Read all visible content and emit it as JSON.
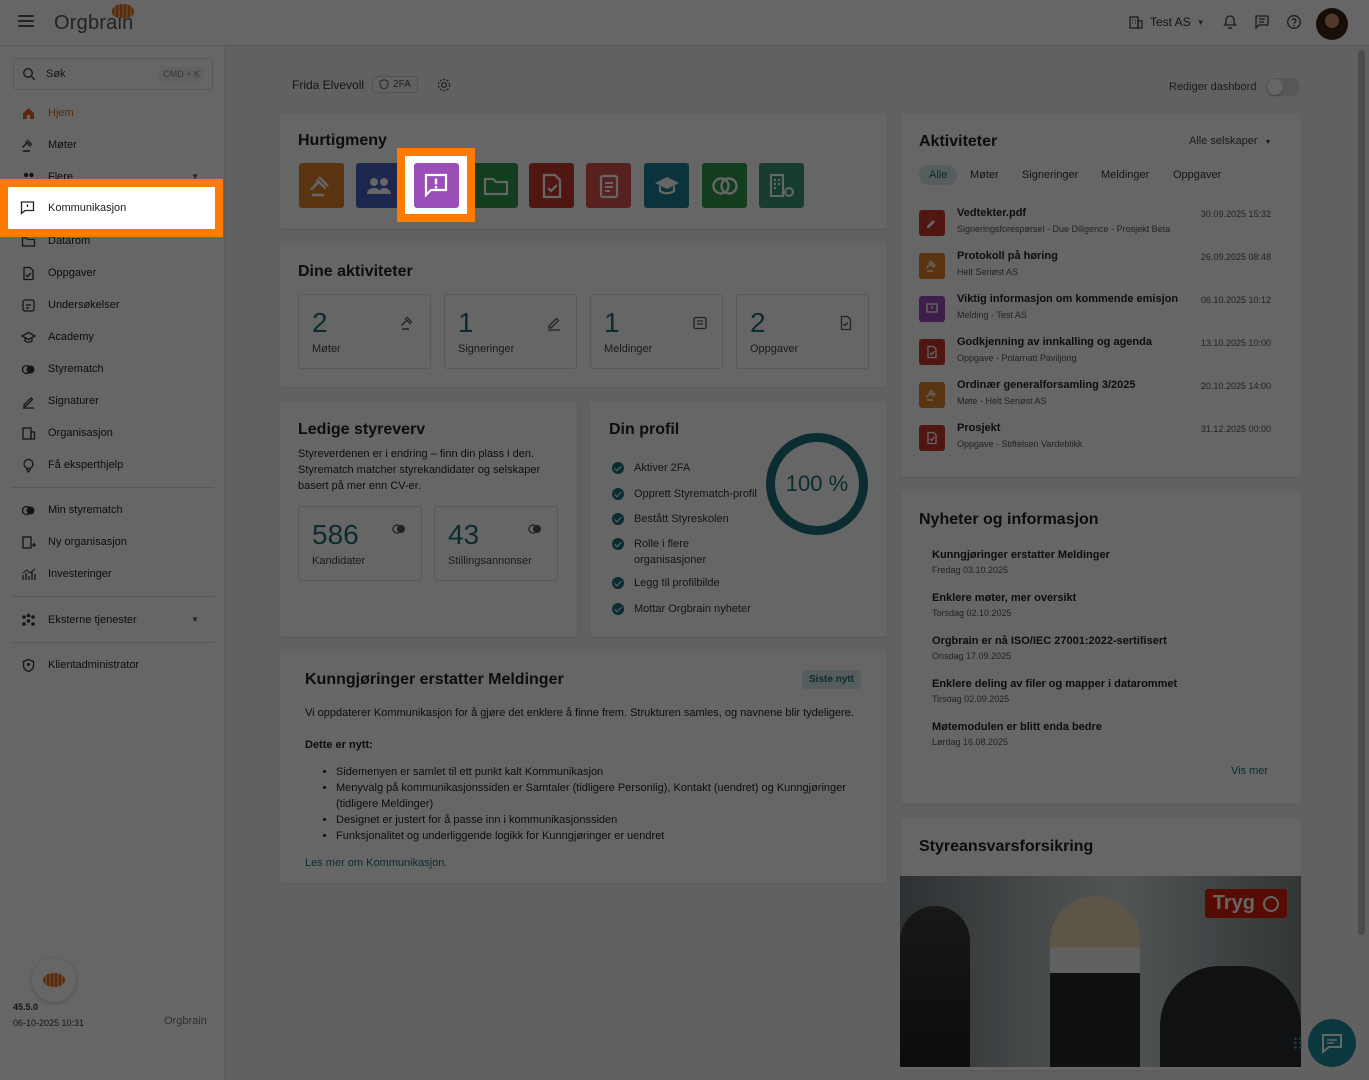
{
  "app": {
    "logo": "Orgbrain",
    "company": "Test AS"
  },
  "search": {
    "label": "Søk",
    "shortcut": "CMD + K"
  },
  "sidebar": {
    "items": [
      {
        "label": "Hjem",
        "icon": "home-icon"
      },
      {
        "label": "Møter",
        "icon": "gavel-icon"
      },
      {
        "label": "Flere",
        "icon": "users-icon"
      },
      {
        "label": "Kommunikasjon",
        "icon": "message-icon"
      },
      {
        "label": "Datarom",
        "icon": "folder-icon"
      },
      {
        "label": "Oppgaver",
        "icon": "task-icon"
      },
      {
        "label": "Undersøkelser",
        "icon": "survey-icon"
      },
      {
        "label": "Academy",
        "icon": "academy-icon"
      },
      {
        "label": "Styrematch",
        "icon": "styrematch-icon"
      },
      {
        "label": "Signaturer",
        "icon": "signature-icon"
      },
      {
        "label": "Organisasjon",
        "icon": "building-icon"
      },
      {
        "label": "Få eksperthjelp",
        "icon": "expert-icon"
      },
      {
        "label": "Min styrematch",
        "icon": "styrematch-icon"
      },
      {
        "label": "Ny organisasjon",
        "icon": "building-add-icon"
      },
      {
        "label": "Investeringer",
        "icon": "chart-icon"
      },
      {
        "label": "Eksterne tjenester",
        "icon": "services-icon"
      },
      {
        "label": "Klientadministrator",
        "icon": "admin-icon"
      }
    ],
    "version": "45.5.0",
    "build_date": "06-10-2025 10:31",
    "footer_logo": "Orgbrain"
  },
  "header": {
    "user_name": "Frida Elvevoll",
    "badge": "2FA",
    "edit_dashboard": "Rediger dashbord"
  },
  "quick_menu": {
    "title": "Hurtigmeny",
    "items": [
      {
        "icon": "gavel-icon",
        "color": "#e0822b"
      },
      {
        "icon": "users-icon",
        "color": "#4a5fc1"
      },
      {
        "icon": "announcement-icon",
        "color": "#9b4db8"
      },
      {
        "icon": "folder-icon",
        "color": "#2e9a4c"
      },
      {
        "icon": "task-icon",
        "color": "#c8372d"
      },
      {
        "icon": "survey-icon",
        "color": "#d9534f"
      },
      {
        "icon": "academy-icon",
        "color": "#1c7f9a"
      },
      {
        "icon": "styrematch-icon",
        "color": "#2e9a4c"
      },
      {
        "icon": "building-settings-icon",
        "color": "#3a9a7a"
      }
    ]
  },
  "activities_summary": {
    "title": "Dine aktiviteter",
    "items": [
      {
        "value": "2",
        "label": "Møter"
      },
      {
        "value": "1",
        "label": "Signeringer"
      },
      {
        "value": "1",
        "label": "Meldinger"
      },
      {
        "value": "2",
        "label": "Oppgaver"
      }
    ]
  },
  "board_positions": {
    "title": "Ledige styreverv",
    "description": "Styreverdenen er i endring – finn din plass i den. Styrematch matcher styrekandidater og selskaper basert på mer enn CV-er.",
    "stats": [
      {
        "value": "586",
        "label": "Kandidater"
      },
      {
        "value": "43",
        "label": "Stillingsannonser"
      }
    ]
  },
  "profile": {
    "title": "Din profil",
    "progress_label": "100 %",
    "progress": 100,
    "items": [
      "Aktiver 2FA",
      "Opprett Styrematch-profil",
      "Bestått Styreskolen",
      "Rolle i flere organisasjoner",
      "Legg til profilbilde",
      "Mottar Orgbrain nyheter"
    ]
  },
  "announcement": {
    "title": "Kunngjøringer erstatter Meldinger",
    "tag": "Siste nytt",
    "intro": "Vi oppdaterer Kommunikasjon for å gjøre det enklere å finne frem. Strukturen samles, og navnene blir tydeligere.",
    "subheading": "Dette er nytt:",
    "bullets": [
      "Sidemenyen er samlet til ett punkt kalt Kommunikasjon",
      "Menyvalg på kommunikasjonssiden er Samtaler (tidligere Personlig), Kontakt (uendret) og Kunngjøringer (tidligere Meldinger)",
      "Designet er justert for å passe inn i kommunikasjonssiden",
      "Funksjonalitet og underliggende logikk for Kunngjøringer er uendret"
    ],
    "link": "Les mer om Kommunikasjon."
  },
  "activities": {
    "title": "Aktiviteter",
    "filter": "Alle selskaper",
    "tabs": [
      "Alle",
      "Møter",
      "Signeringer",
      "Meldinger",
      "Oppgaver"
    ],
    "items": [
      {
        "title": "Vedtekter.pdf",
        "sub": "Signeringsforespørsel - Due Diligence - Prosjekt Beta",
        "date": "30.09.2025 15:32",
        "color": "#c8372d",
        "icon": "signature-icon"
      },
      {
        "title": "Protokoll på høring",
        "sub": "Helt Seriøst AS",
        "date": "26.09.2025 08:48",
        "color": "#e0822b",
        "icon": "gavel-icon"
      },
      {
        "title": "Viktig informasjon om kommende emisjon",
        "sub": "Melding - Test AS",
        "date": "06.10.2025 10:12",
        "color": "#9b4db8",
        "icon": "announcement-icon"
      },
      {
        "title": "Godkjenning av innkalling og agenda",
        "sub": "Oppgave - Polarnatt Paviljong",
        "date": "13.10.2025 10:00",
        "color": "#c8372d",
        "icon": "task-icon"
      },
      {
        "title": "Ordinær generalforsamling 3/2025",
        "sub": "Møte - Helt Seriøst AS",
        "date": "20.10.2025 14:00",
        "color": "#e0822b",
        "icon": "gavel-icon"
      },
      {
        "title": "Prosjekt",
        "sub": "Oppgave - Stiftelsen Vardeblikk",
        "date": "31.12.2025 00:00",
        "color": "#c8372d",
        "icon": "task-icon"
      }
    ]
  },
  "news": {
    "title": "Nyheter og informasjon",
    "items": [
      {
        "title": "Kunngjøringer erstatter Meldinger",
        "date": "Fredag 03.10.2025"
      },
      {
        "title": "Enklere møter, mer oversikt",
        "date": "Torsdag 02.10.2025"
      },
      {
        "title": "Orgbrain er nå ISO/IEC 27001:2022-sertifisert",
        "date": "Onsdag 17.09.2025"
      },
      {
        "title": "Enklere deling av filer og mapper i datarommet",
        "date": "Tirsdag 02.09.2025"
      },
      {
        "title": "Møtemodulen er blitt enda bedre",
        "date": "Lørdag 16.08.2025"
      }
    ],
    "more": "Vis mer"
  },
  "insurance": {
    "title": "Styreansvarsforsikring",
    "brand": "Tryg"
  }
}
